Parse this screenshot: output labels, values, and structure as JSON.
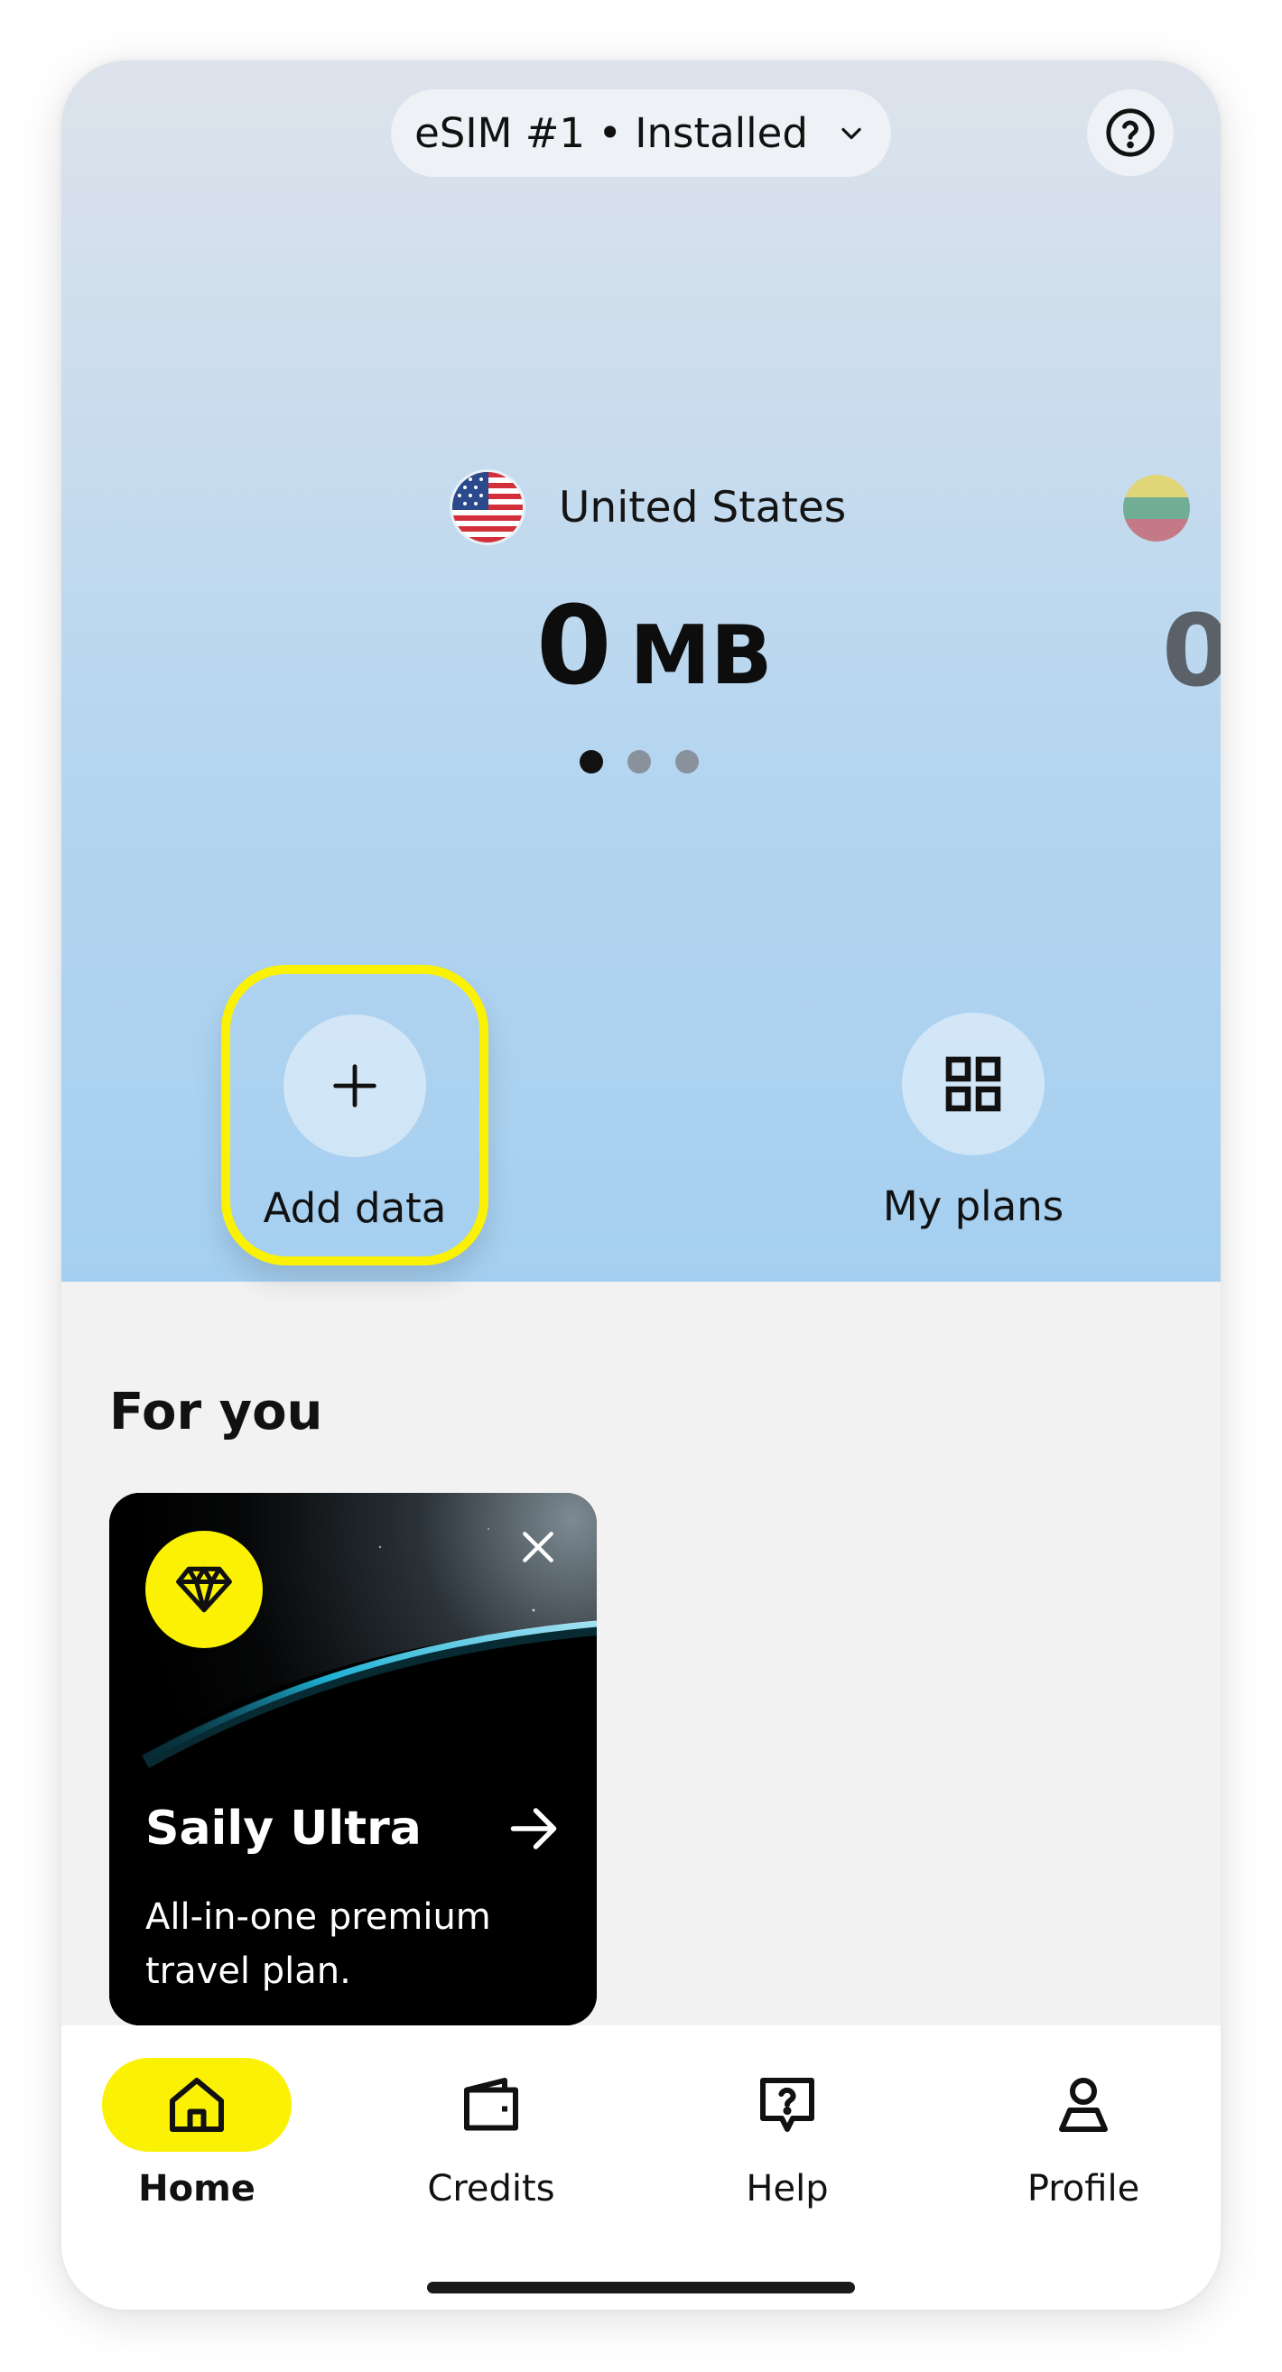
{
  "esim": {
    "label": "eSIM #1 • Installed",
    "chevron_icon": "chevron-down-icon"
  },
  "help_icon": "question-circle-icon",
  "carousel": {
    "current": {
      "country": "United States",
      "flag_icon": "flag-us-icon",
      "amount": "0",
      "unit": "MB"
    },
    "next": {
      "flag_icon": "flag-lt-icon",
      "amount": "0"
    },
    "pages": 3,
    "active_page": 1
  },
  "actions": {
    "add_data": {
      "label": "Add data",
      "icon": "plus-icon"
    },
    "my_plans": {
      "label": "My plans",
      "icon": "grid-icon"
    }
  },
  "for_you": {
    "title": "For you",
    "card": {
      "title": "Saily Ultra",
      "description": "All-in-one premium travel plan.",
      "badge_icon": "diamond-icon",
      "close_icon": "close-icon",
      "arrow_icon": "arrow-right-icon"
    }
  },
  "nav": {
    "items": [
      {
        "label": "Home",
        "icon": "home-icon",
        "active": true
      },
      {
        "label": "Credits",
        "icon": "wallet-icon",
        "active": false
      },
      {
        "label": "Help",
        "icon": "help-chat-icon",
        "active": false
      },
      {
        "label": "Profile",
        "icon": "profile-icon",
        "active": false
      }
    ]
  },
  "colors": {
    "accent": "#fbf104",
    "hero_top": "#dde3ec",
    "hero_bottom": "#a5cff0",
    "background": "#f2f2f2"
  }
}
